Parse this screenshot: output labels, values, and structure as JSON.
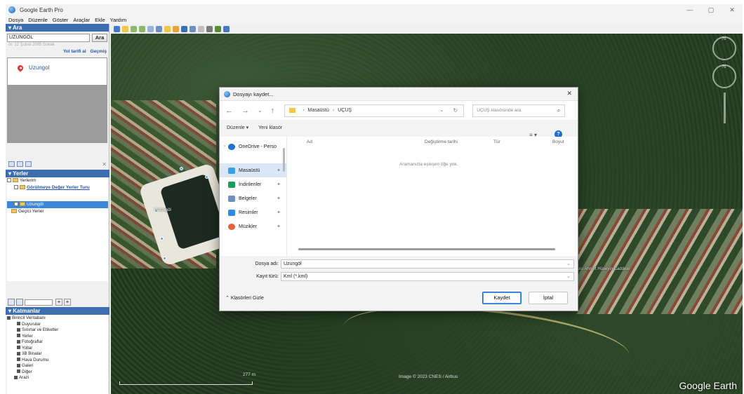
{
  "window": {
    "title": "Google Earth Pro",
    "controls": [
      "—",
      "▢",
      "✕"
    ]
  },
  "menu": [
    "Dosya",
    "Düzenle",
    "Göster",
    "Araçlar",
    "Ekle",
    "Yardım"
  ],
  "search": {
    "header": "▾ Ara",
    "query": "UZUNGÖL",
    "button": "Ara",
    "hint": "ör. 12 Şubat 2005 Sokak",
    "links": [
      "Yol tarifi al",
      "Geçmiş"
    ],
    "result": "Uzungol"
  },
  "places": {
    "header": "▾ Yerler",
    "tree": [
      {
        "label": "Yerlerim",
        "indent": 0
      },
      {
        "label": "Görülmeye Değer Yerler Turu",
        "indent": 1,
        "link": true
      },
      {
        "label": "Uzungöl",
        "indent": 1,
        "selected": true
      },
      {
        "label": "Geçici Yerler",
        "indent": 0
      }
    ]
  },
  "layers": {
    "header": "▾ Katmanlar",
    "items": [
      "Birincil Veritabanı",
      "Duyurular",
      "Sınırlar ve Etiketler",
      "Yerler",
      "Fotoğraflar",
      "Yollar",
      "3B Binalar",
      "Hava Durumu",
      "Galeri",
      "Diğer",
      "Arazi"
    ]
  },
  "map": {
    "place_label": "Uzungöl",
    "road_label": "Duru Ahmet Hüseyin Caddesi",
    "copyright": "Image © 2023 CNES / Airbus",
    "scale": "277 m",
    "brand": "Google Earth"
  },
  "dialog": {
    "title": "Dosyayı kaydet...",
    "path": [
      "Masaüstü",
      "UÇUŞ"
    ],
    "search_placeholder": "UÇUŞ klasöründe ara",
    "organize": "Düzenle ▾",
    "new_folder": "Yeni klasör",
    "nav_items": [
      {
        "label": "OneDrive - Perso",
        "color": "#1e72d0"
      },
      {
        "label": "Masaüstü",
        "color": "#3aa0e8",
        "selected": true
      },
      {
        "label": "İndirilenler",
        "color": "#1b9e5a"
      },
      {
        "label": "Belgeler",
        "color": "#6e8fc0"
      },
      {
        "label": "Resimler",
        "color": "#2e8ae6"
      },
      {
        "label": "Müzikler",
        "color": "#e8603c"
      }
    ],
    "columns": [
      "Ad",
      "Değiştirme tarihi",
      "Tür",
      "Boyut"
    ],
    "empty_message": "Aramanızla eşleşen öğe yok.",
    "filename_label": "Dosya adı:",
    "filename": "Uzungöl",
    "filetype_label": "Kayıt türü:",
    "filetype": "Kml (*.kml)",
    "hide_folders": "Klasörleri Gizle",
    "save": "Kaydet",
    "cancel": "İptal"
  }
}
